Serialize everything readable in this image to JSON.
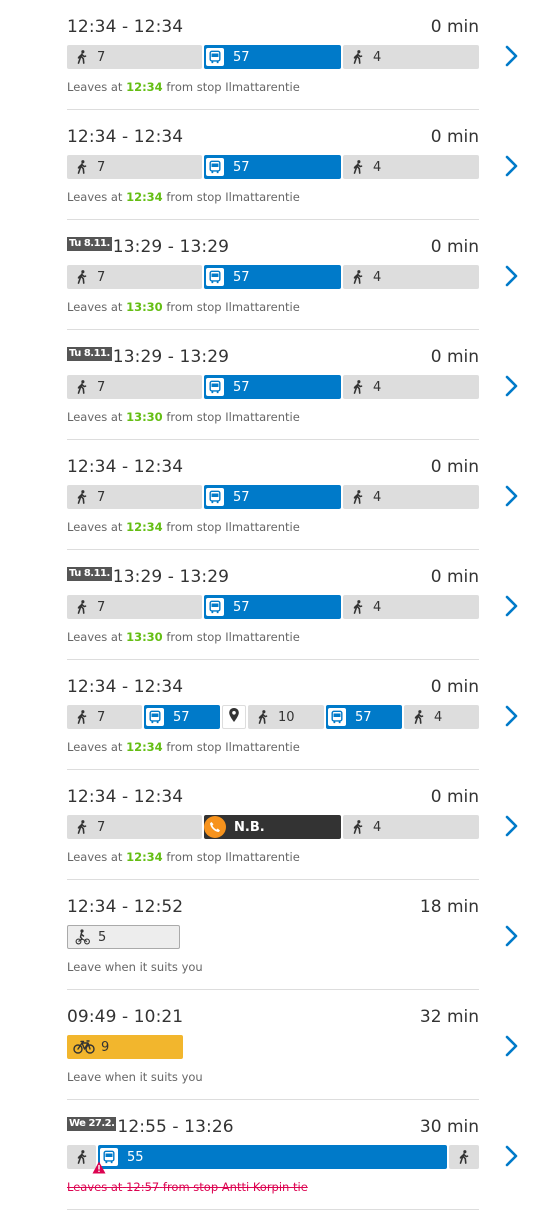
{
  "colors": {
    "bus": "#007ac9",
    "walk": "#dddddd",
    "call": "#333333",
    "citybike": "#f2b62d",
    "highlight": "#64be14",
    "cancelled": "#dc0451",
    "chevron": "#007ac9"
  },
  "itineraries": [
    {
      "time": "12:34 - 12:34",
      "duration": "0 min",
      "legs": {
        "walk1": "7",
        "bus1": "57",
        "walk2": "4"
      },
      "note": {
        "prefix": "Leaves at",
        "time": "12:34",
        "suffix": "from stop Ilmattarentie"
      }
    },
    {
      "time": "12:34 - 12:34",
      "duration": "0 min",
      "legs": {
        "walk1": "7",
        "bus1": "57",
        "walk2": "4"
      },
      "note": {
        "prefix": "Leaves at",
        "time": "12:34",
        "suffix": "from stop Ilmattarentie"
      }
    },
    {
      "date": "Tu 8.11.",
      "time": "13:29 - 13:29",
      "duration": "0 min",
      "legs": {
        "walk1": "7",
        "bus1": "57",
        "walk2": "4"
      },
      "note": {
        "prefix": "Leaves at",
        "time": "13:30",
        "suffix": "from stop Ilmattarentie"
      }
    },
    {
      "date": "Tu 8.11.",
      "time": "13:29 - 13:29",
      "duration": "0 min",
      "legs": {
        "walk1": "7",
        "bus1": "57",
        "walk2": "4"
      },
      "note": {
        "prefix": "Leaves at",
        "time": "13:30",
        "suffix": "from stop Ilmattarentie"
      }
    },
    {
      "time": "12:34 - 12:34",
      "duration": "0 min",
      "legs": {
        "walk1": "7",
        "bus1": "57",
        "walk2": "4"
      },
      "note": {
        "prefix": "Leaves at",
        "time": "12:34",
        "suffix": "from stop Ilmattarentie"
      }
    },
    {
      "date": "Tu 8.11.",
      "time": "13:29 - 13:29",
      "duration": "0 min",
      "legs": {
        "walk1": "7",
        "bus1": "57",
        "walk2": "4"
      },
      "note": {
        "prefix": "Leaves at",
        "time": "13:30",
        "suffix": "from stop Ilmattarentie"
      }
    },
    {
      "time": "12:34 - 12:34",
      "duration": "0 min",
      "legs": {
        "walk1": "7",
        "bus1": "57",
        "walk2": "10",
        "bus2": "57",
        "walk3": "4"
      },
      "note": {
        "prefix": "Leaves at",
        "time": "12:34",
        "suffix": "from stop Ilmattarentie"
      }
    },
    {
      "time": "12:34 - 12:34",
      "duration": "0 min",
      "legs": {
        "walk1": "7",
        "call": "N.B.",
        "walk2": "4"
      },
      "note": {
        "prefix": "Leaves at",
        "time": "12:34",
        "suffix": "from stop Ilmattarentie"
      }
    },
    {
      "time": "12:34 - 12:52",
      "duration": "18 min",
      "legs": {
        "bike": "5"
      },
      "note": {
        "prefix": "Leave when it suits you"
      }
    },
    {
      "time": "09:49 - 10:21",
      "duration": "32 min",
      "legs": {
        "citybike": "9"
      },
      "note": {
        "prefix": "Leave when it suits you"
      }
    },
    {
      "date": "We 27.2.",
      "time": "12:55 - 13:26",
      "duration": "30 min",
      "legs": {
        "bus1": "55"
      },
      "note": {
        "prefix": "Leaves at",
        "time": "12:57",
        "suffix": "from stop Antti Korpin tie"
      }
    }
  ]
}
